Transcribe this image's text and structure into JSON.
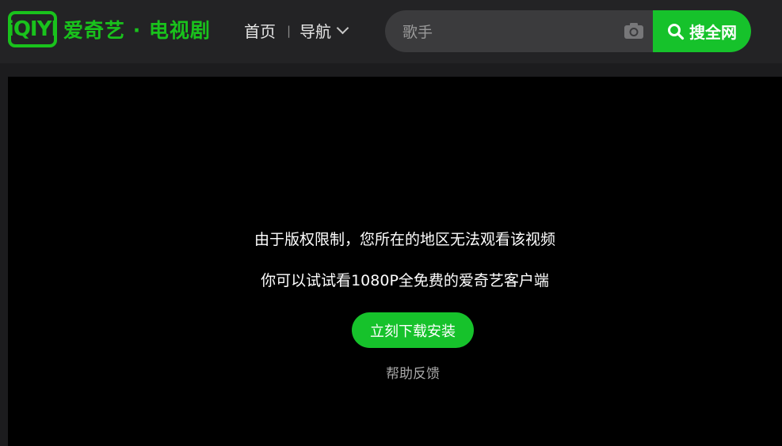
{
  "header": {
    "logo_mark": "iQIYI",
    "logo_text": "爱奇艺 · 电视剧",
    "nav": {
      "home_label": "首页",
      "separator": "|",
      "guide_label": "导航"
    },
    "search": {
      "placeholder": "歌手",
      "button_label": "搜全网",
      "camera_icon": "camera-icon",
      "search_icon": "search-icon"
    }
  },
  "player": {
    "restriction_message": "由于版权限制，您所在的地区无法观看该视频",
    "suggestion_message": "你可以试试看1080P全免费的爱奇艺客户端",
    "install_button_label": "立刻下载安装",
    "help_link_label": "帮助反馈"
  },
  "colors": {
    "brand_green": "#19c21c",
    "button_green": "#16c22b",
    "header_bg": "#232325",
    "player_bg": "#000000"
  }
}
